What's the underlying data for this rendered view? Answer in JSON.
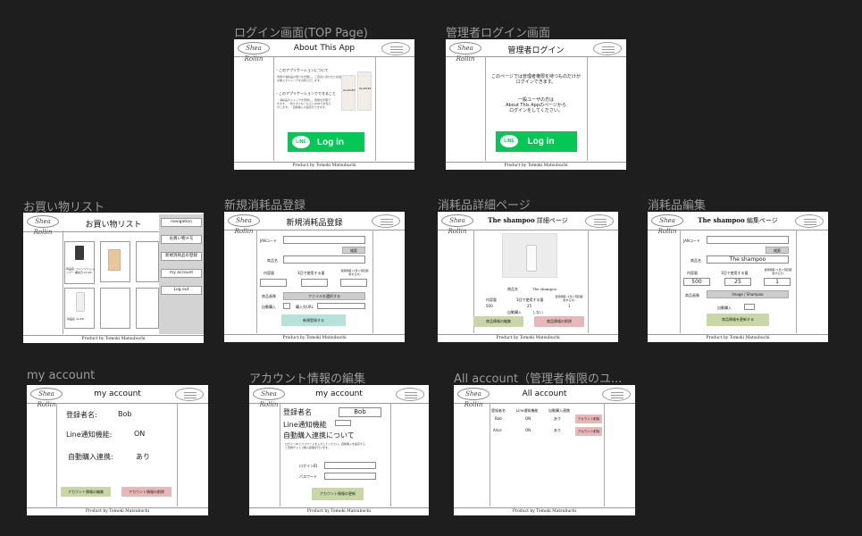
{
  "brand": "Shea Rollin",
  "footer": "Product by Tomoki Matsubuchi",
  "screens": {
    "top": {
      "title": "ログイン画面(TOP Page)",
      "header": "About This App",
      "about_heading": "・このアプリケーションについて",
      "about_body": "洗剤や消耗品の残りを管理し、ご自身に合わせた最適な購入タイミングをお知らせします。",
      "features_heading": "・このアプリケーションでできること",
      "features_body": "・消耗品のストックを登録し、残量を管理できます。・残りが少なくなるとLINEでお知らせします。・自動購入の設定ができます。",
      "product_label": "OLAPLEX",
      "line_badge": "LINE",
      "login_label": "Log in"
    },
    "admin_login": {
      "title": "管理者ログイン画面",
      "header": "管理者ログイン",
      "notice1": "このページでは管理者権限を持つものだけが",
      "notice2": "ログインできます。",
      "notice3": "一般ユーザの方は",
      "notice4": "About This Appのページから",
      "notice5": "ログインをしてください。",
      "line_badge": "LINE",
      "login_label": "Log in"
    },
    "shopping": {
      "title": "お買い物リスト",
      "header": "お買い物リスト",
      "item1_text": "商品名: フィンゾンシャンプー 補充日:11/20",
      "item2_text": "商品名 11/28",
      "menu": [
        "navigation",
        "お買い物メモ",
        "新規消耗品の登録",
        "my account",
        "Log out"
      ]
    },
    "new_item": {
      "title": "新規消耗品登録",
      "header": "新規消耗品登録",
      "jan_label": "JANコード",
      "search_btn": "検索",
      "name_label": "商品名",
      "capacity_label": "内容量",
      "usage_label": "1回で使用する量",
      "count_label": "使用頻度 (1日に何回使用するか)",
      "image_label": "商品画像",
      "file_btn": "ファイルを選択する",
      "auto_label": "自動購入",
      "buy_label": "購入先URL",
      "register_btn": "新規登録する"
    },
    "detail": {
      "title": "消耗品詳細ページ",
      "header_em": "The shampoo",
      "header_rest": " 詳細ページ",
      "name_label": "商品名",
      "name_value": "The shampoo",
      "capacity_label": "内容量",
      "usage_label": "1回で使用する量",
      "count_label": "使用頻度 (1日に何回使用するか)",
      "capacity_value": "500",
      "usage_value": "25",
      "count_value": "1",
      "auto_label": "自動購入",
      "auto_value": "しない",
      "edit_btn": "商品情報の編集",
      "delete_btn": "商品情報の削除"
    },
    "edit_item": {
      "title": "消耗品編集",
      "header_em": "The shampoo",
      "header_rest": " 編集ページ",
      "jan_label": "JANコード",
      "search_btn": "検索",
      "name_label": "商品名",
      "name_value": "The shampoo",
      "capacity_label": "内容量",
      "usage_label": "1回で使用する量",
      "count_label": "使用頻度 (1日に何回使用するか)",
      "capacity_value": "500",
      "usage_value": "25",
      "count_value": "1",
      "image_label": "商品画像",
      "image_value": "Image / Shampoo",
      "auto_label": "自動購入",
      "update_btn": "商品情報を更新する"
    },
    "my_account": {
      "title": "my account",
      "header": "my account",
      "name_label": "登録者名:",
      "name_value": "Bob",
      "line_label": "Line通知機能:",
      "line_value": "ON",
      "auto_label": "自動購入連携:",
      "auto_value": "あり",
      "edit_btn": "アカウント情報の編集",
      "delete_btn": "アカウント情報の削除"
    },
    "account_edit": {
      "title": "アカウント情報の編集",
      "header": "my account",
      "name_label": "登録者名",
      "name_value": "Bob",
      "line_label": "Line通知機能",
      "auto_label": "自動購入連携について",
      "note": "ログインIDとパスワードを入力してください。自動購入を設定すると登録サイトで購入処理を行います。",
      "login_label": "ログインID",
      "password_label": "パスワード",
      "update_btn": "アカウント情報の更新"
    },
    "all_account": {
      "title": "All account（管理者権限のユ...",
      "header": "All account",
      "columns": [
        "登録者名",
        "Line通知機能",
        "自動購入連携"
      ],
      "rows": [
        {
          "name": "Bob",
          "line": "ON",
          "auto": "あり",
          "action": "アカウント削除"
        },
        {
          "name": "Alice",
          "line": "ON",
          "auto": "あり",
          "action": "アカウント削除"
        }
      ]
    }
  }
}
